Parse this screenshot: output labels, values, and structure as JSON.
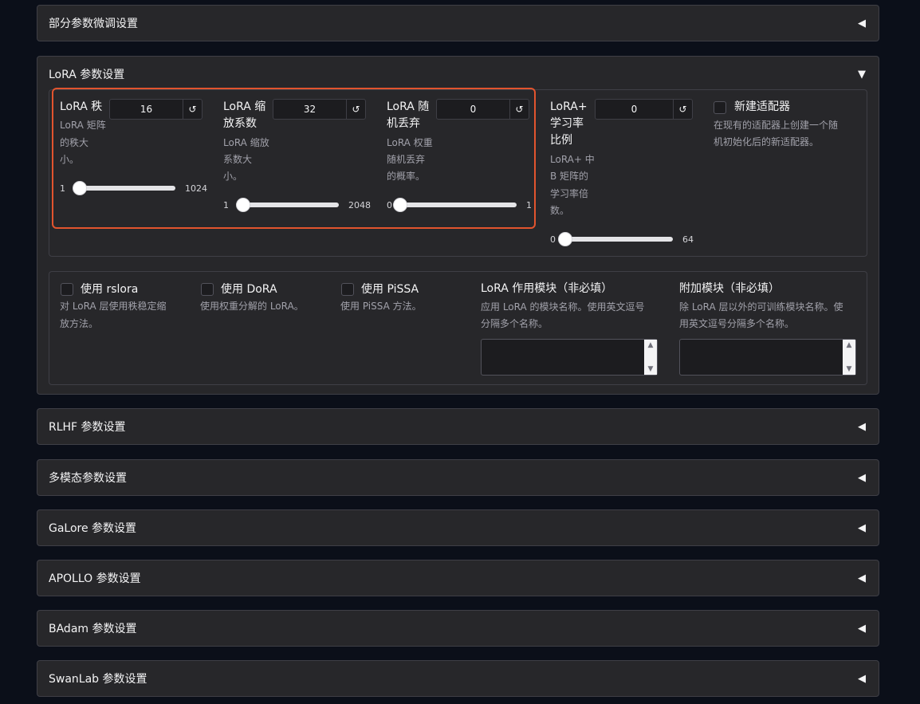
{
  "accordions": {
    "partial": "部分参数微调设置",
    "lora": "LoRA 参数设置",
    "rlhf": "RLHF 参数设置",
    "multimodal": "多模态参数设置",
    "galore": "GaLore 参数设置",
    "apollo": "APOLLO 参数设置",
    "badam": "BAdam 参数设置",
    "swanlab": "SwanLab 参数设置"
  },
  "arrows": {
    "collapsed": "◀",
    "expanded": "▼"
  },
  "lora": {
    "rank": {
      "label_l1": "LoRA 秩",
      "value": "16",
      "info_l1": "LoRA 矩阵",
      "info_l2": "的秩大",
      "info_l3": "小。",
      "min": "1",
      "max": "1024",
      "fraction": 0.015
    },
    "alpha": {
      "label_l1": "LoRA 缩",
      "label_l2": "放系数",
      "value": "32",
      "info_l1": "LoRA 缩放",
      "info_l2": "系数大",
      "info_l3": "小。",
      "min": "1",
      "max": "2048",
      "fraction": 0.015
    },
    "dropout": {
      "label_l1": "LoRA 随",
      "label_l2": "机丢弃",
      "value": "0",
      "info_l1": "LoRA 权重",
      "info_l2": "随机丢弃",
      "info_l3": "的概率。",
      "min": "0",
      "max": "1",
      "fraction": 0
    },
    "loraplus": {
      "label_l1": "LoRA+",
      "label_l2": "学习率",
      "label_l3": "比例",
      "value": "0",
      "info_l1": "LoRA+ 中",
      "info_l2": "B 矩阵的",
      "info_l3": "学习率倍",
      "info_l4": "数。",
      "min": "0",
      "max": "64",
      "fraction": 0
    },
    "new_adapter": {
      "label": "新建适配器",
      "info_l1": "在现有的适配器上创建一个随",
      "info_l2": "机初始化后的新适配器。"
    },
    "rslora": {
      "label": "使用 rslora",
      "info_l1": "对 LoRA 层使用秩稳定缩",
      "info_l2": "放方法。"
    },
    "dora": {
      "label": "使用 DoRA",
      "info_l1": "使用权重分解的 LoRA。"
    },
    "pissa": {
      "label": "使用 PiSSA",
      "info_l1": "使用 PiSSA 方法。"
    },
    "target": {
      "label": "LoRA 作用模块（非必填）",
      "info_l1": "应用 LoRA 的模块名称。使用英文逗号",
      "info_l2": "分隔多个名称。",
      "value": ""
    },
    "additional": {
      "label": "附加模块（非必填）",
      "info_l1": "除 LoRA 层以外的可训练模块名称。使",
      "info_l2": "用英文逗号分隔多个名称。",
      "value": ""
    }
  },
  "icons": {
    "reset": "↺",
    "scroll_up": "▲",
    "scroll_down": "▼"
  },
  "colors": {
    "highlight": "#e2542e",
    "background": "#0b0f19",
    "panel": "#27272a"
  }
}
